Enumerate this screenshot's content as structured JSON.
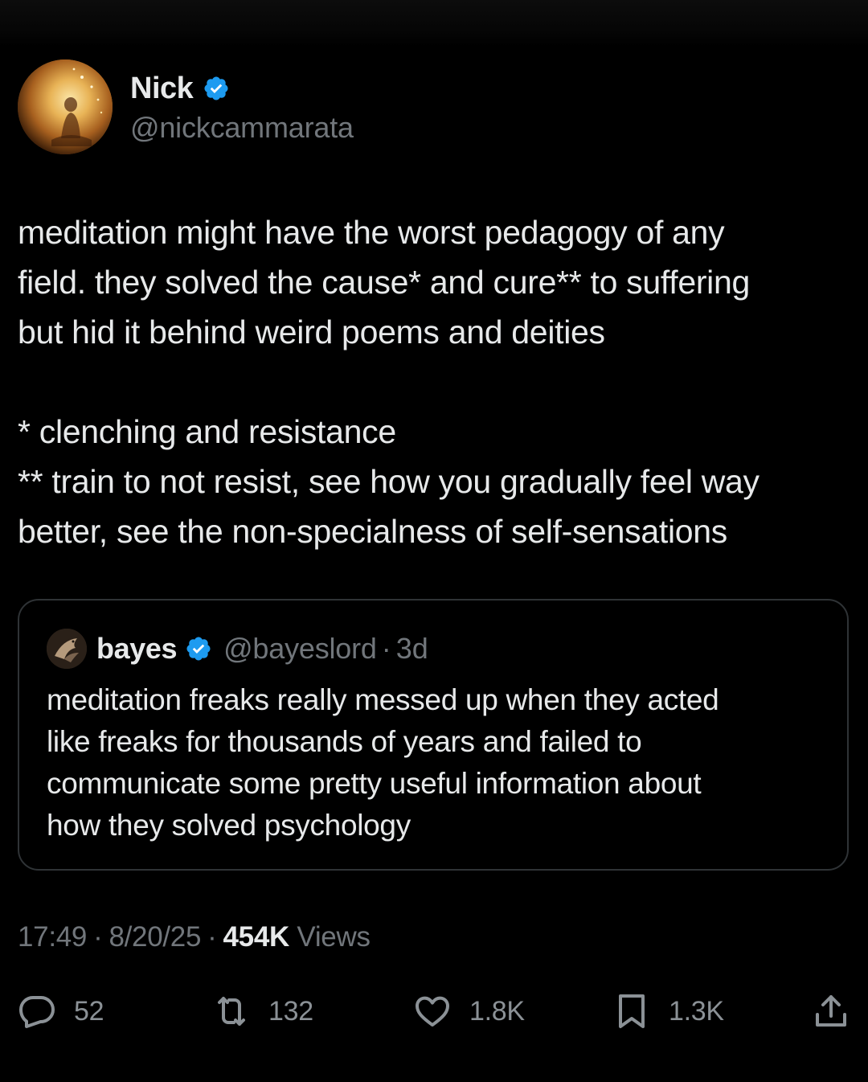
{
  "author": {
    "display_name": "Nick",
    "handle": "@nickcammarata",
    "avatar_icon": "avatar-meditating-figure-icon",
    "verified_color": "#1d9bf0"
  },
  "tweet": {
    "lines": [
      "meditation might have the worst pedagogy of any",
      "field. they solved the cause* and cure** to suffering",
      "but hid it behind weird poems and deities",
      "",
      "* clenching and resistance",
      "** train to not resist, see how you gradually feel way",
      "better, see the non-specialness of self-sensations"
    ]
  },
  "quoted": {
    "display_name": "bayes",
    "handle": "@bayeslord",
    "separator": "·",
    "time": "3d",
    "lines": [
      "meditation freaks really messed up when they acted",
      "like freaks for thousands of years and failed to",
      "communicate some pretty useful information about",
      "how they solved psychology"
    ]
  },
  "meta": {
    "time": "17:49",
    "separator": "·",
    "date": "8/20/25",
    "views_count": "454K",
    "views_label": "Views"
  },
  "actions": {
    "replies": "52",
    "reposts": "132",
    "likes": "1.8K",
    "bookmarks": "1.3K",
    "icons": [
      "reply-icon",
      "repost-icon",
      "like-icon",
      "bookmark-icon",
      "share-icon"
    ]
  },
  "colors": {
    "background": "#000000",
    "text": "#e7e9ea",
    "secondary": "#71767b",
    "border": "#2f3336",
    "verified": "#1d9bf0"
  }
}
